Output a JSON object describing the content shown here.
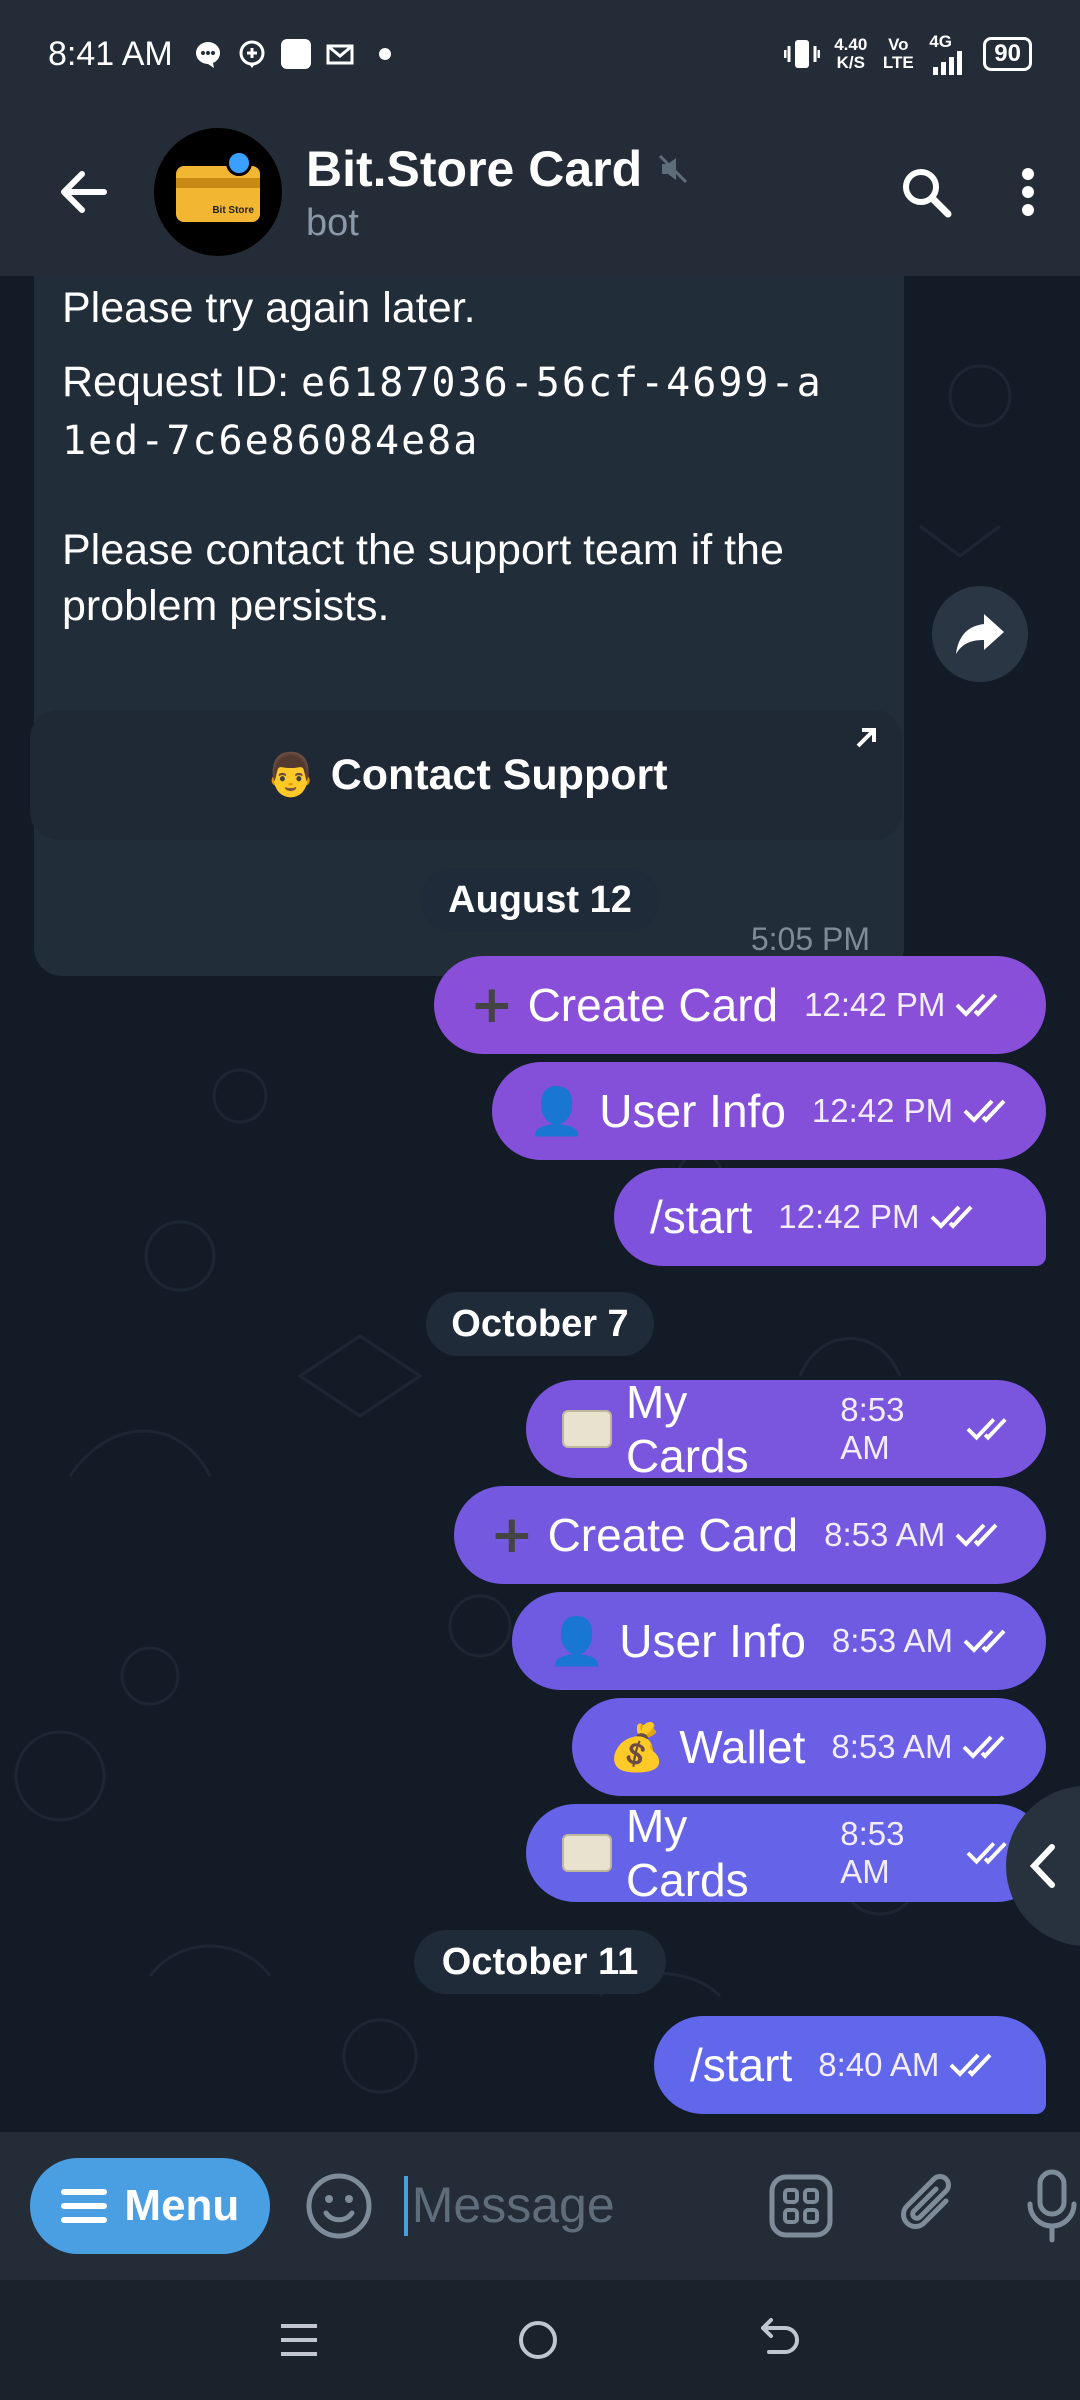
{
  "status_bar": {
    "time": "8:41 AM",
    "speed_value": "4.40",
    "speed_unit": "K/S",
    "volte": "Vo LTE",
    "network": "4G",
    "battery": "90"
  },
  "header": {
    "title": "Bit.Store Card",
    "subtitle": "bot",
    "avatar_text": "Bit Store"
  },
  "bot_message": {
    "line1": "Please try again later.",
    "request_label": "Request ID:",
    "request_id_1": "e6187036-56cf-4699-a",
    "request_id_2": "1ed-7c6e86084e8a",
    "line3": "Please contact the support team if the",
    "line4": "problem persists.",
    "time": "5:05 PM"
  },
  "contact_button": {
    "label": "Contact Support"
  },
  "dates": {
    "aug": "August 12",
    "oct7": "October 7",
    "oct11": "October 11"
  },
  "messages": [
    {
      "text": "Create Card",
      "time": "12:42 PM",
      "icon": "plus-emoji"
    },
    {
      "text": "User Info",
      "time": "12:42 PM",
      "icon": "bust-emoji"
    },
    {
      "text": "/start",
      "time": "12:42 PM",
      "icon": ""
    },
    {
      "text": "My Cards",
      "time": "8:53 AM",
      "icon": "credit-card-emoji"
    },
    {
      "text": "Create Card",
      "time": "8:53 AM",
      "icon": "plus-emoji"
    },
    {
      "text": "User Info",
      "time": "8:53 AM",
      "icon": "bust-emoji"
    },
    {
      "text": "Wallet",
      "time": "8:53 AM",
      "icon": "money-bag-emoji"
    },
    {
      "text": "My Cards",
      "time": "8:53 AM",
      "icon": "credit-card-emoji"
    },
    {
      "text": "/start",
      "time": "8:40 AM",
      "icon": ""
    }
  ],
  "input_bar": {
    "menu_label": "Menu",
    "placeholder": "Message"
  },
  "colors": {
    "header_bg": "#232c37",
    "chat_bg": "#121b26",
    "bubble_out_top": "#8a4fd8",
    "bubble_out_bottom": "#6a6ef0",
    "menu_btn": "#4a9fe3"
  }
}
